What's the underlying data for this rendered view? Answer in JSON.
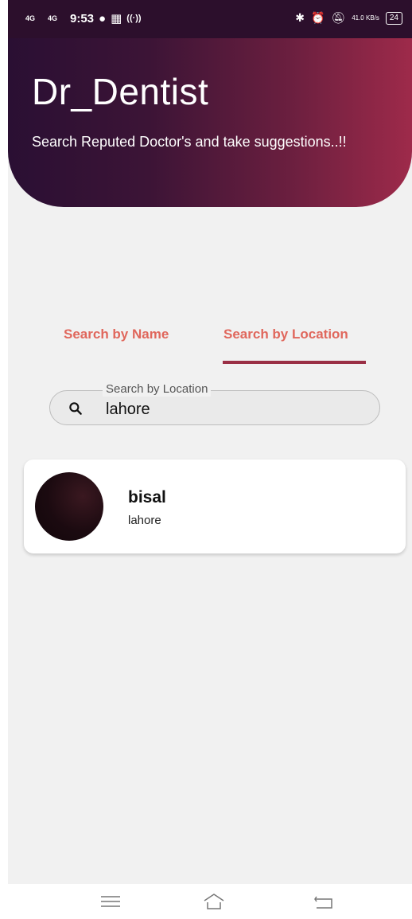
{
  "status_bar": {
    "net1": "4G",
    "net2": "4G",
    "time": "9:53",
    "speed": "41.0 KB/s",
    "battery": "24"
  },
  "app": {
    "title": "Dr_Dentist",
    "subtitle": "Search Reputed Doctor's and take suggestions..!!"
  },
  "tabs": [
    {
      "label": "Search by Name",
      "active": false
    },
    {
      "label": "Search by Location",
      "active": true
    }
  ],
  "search": {
    "label": "Search by Location",
    "value": "lahore",
    "icon": "search-icon"
  },
  "results": [
    {
      "name": "bisal",
      "location": "lahore",
      "avatar_icon": "avatar"
    }
  ],
  "nav": {
    "menu_icon": "menu-icon",
    "home_icon": "home-icon",
    "back_icon": "back-icon"
  },
  "colors": {
    "header_gradient_start": "#2a0f33",
    "header_gradient_end": "#9e2a4a",
    "tab_text": "#e0675c",
    "tab_indicator": "#9a2f45"
  }
}
